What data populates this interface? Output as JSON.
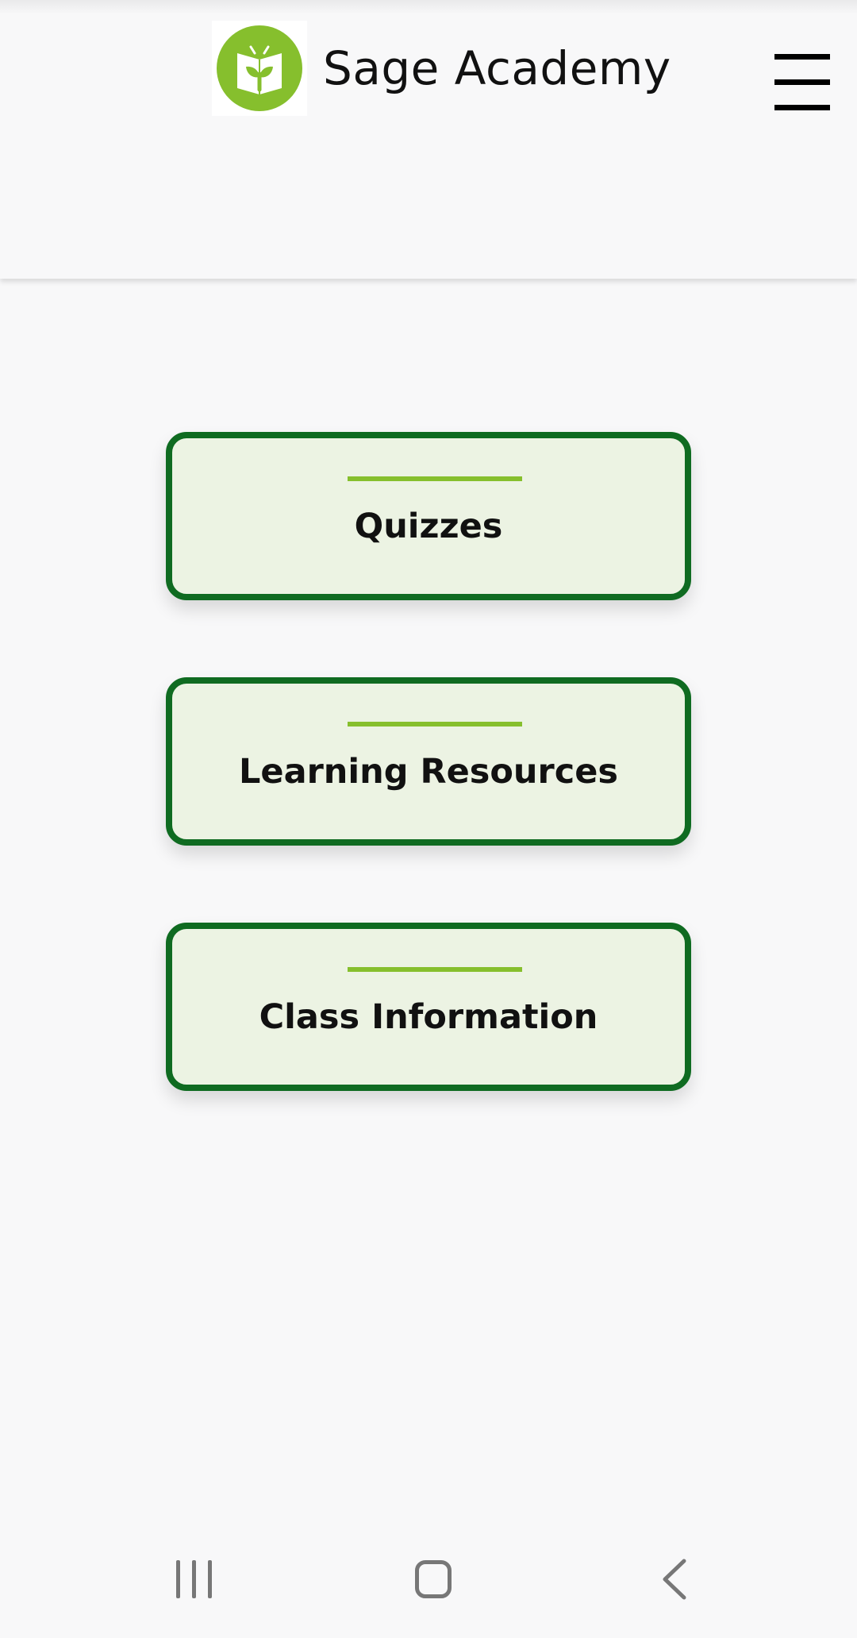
{
  "app": {
    "name": "Sage Academy",
    "brand_color": "#86bf2d",
    "border_color": "#0f6b21",
    "card_background": "#ecf3e3"
  },
  "header": {
    "logo_icon": "book-sprout-logo",
    "menu_icon": "hamburger-menu-icon"
  },
  "menu": {
    "items": [
      {
        "label": "Quizzes"
      },
      {
        "label": "Learning Resources"
      },
      {
        "label": "Class Information"
      }
    ]
  },
  "system_nav": {
    "icons": [
      "recent-apps-icon",
      "home-icon",
      "back-icon"
    ]
  }
}
